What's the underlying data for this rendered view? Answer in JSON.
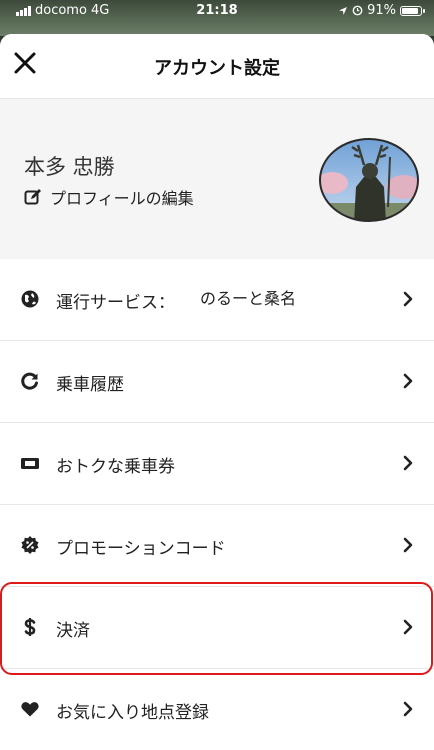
{
  "status_bar": {
    "carrier": "docomo",
    "network": "4G",
    "time": "21:18",
    "battery": "91%"
  },
  "header": {
    "title": "アカウント設定"
  },
  "profile": {
    "name": "本多 忠勝",
    "edit_label": "プロフィールの編集"
  },
  "menu": {
    "items": [
      {
        "label": "運行サービス："
      },
      {
        "label": "乗車履歴"
      },
      {
        "label": "おトクな乗車券"
      },
      {
        "label": "プロモーションコード"
      },
      {
        "label": "決済"
      },
      {
        "label": "お気に入り地点登録"
      }
    ],
    "service_value": "のるーと桑名"
  },
  "colors": {
    "highlight": "#e01818",
    "icon": "#222222",
    "profile_bg": "#f5f5f5"
  },
  "icons": {
    "close": "close-icon",
    "edit": "edit-icon",
    "service": "globe-icon",
    "history": "refresh-icon",
    "ticket": "ticket-icon",
    "promo": "badge-percent-icon",
    "payment": "dollar-icon",
    "favorite": "heart-icon",
    "chevron": "chevron-right-icon"
  }
}
